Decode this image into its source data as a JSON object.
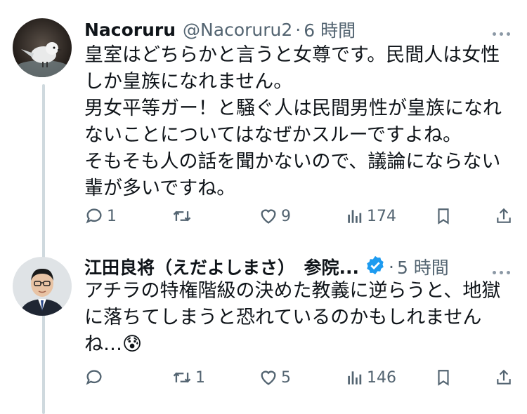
{
  "tweets": [
    {
      "author_name": "Nacoruru",
      "handle": "@Nacoruru2",
      "separator": "·",
      "time": "6 時間",
      "body": "皇室はどちらかと言うと女尊です。民間人は女性しか皇族になれません。\n男女平等ガー！と騒ぐ人は民間男性が皇族になれないことについてはなぜかスルーですよね。\nそもそも人の話を聞かないので、議論にならない輩が多いですね。",
      "replies": "1",
      "retweets": "",
      "likes": "9",
      "views": "174",
      "avatar_icon": "bird-photo-avatar"
    },
    {
      "author_name": "江田良将（えだよしまさ）　参院...",
      "handle": "",
      "separator": "·",
      "time": "5 時間",
      "body": "アチラの特権階級の決めた教義に逆らうと、地獄に落ちてしまうと恐れているのかもしれませんね…😰",
      "replies": "",
      "retweets": "1",
      "likes": "5",
      "views": "146",
      "avatar_icon": "man-in-suit-avatar",
      "verified_icon": "verified-badge-icon"
    }
  ],
  "colors": {
    "text": "#0f1419",
    "muted": "#536471",
    "verified": "#1d9bf0",
    "thread_line": "#cfd9de"
  }
}
